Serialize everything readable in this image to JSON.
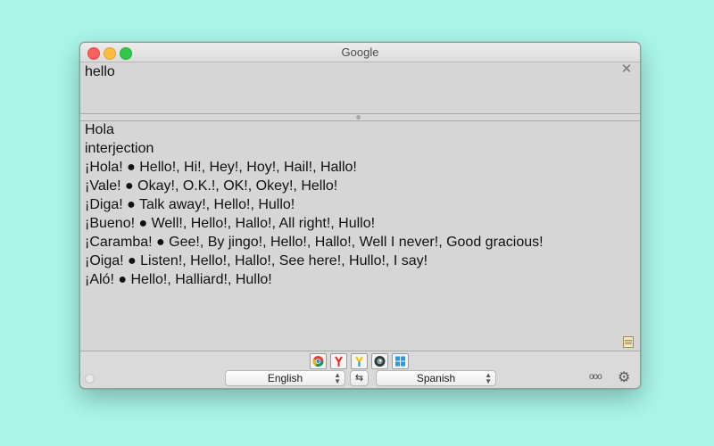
{
  "window": {
    "title": "Google"
  },
  "input": {
    "text": "hello"
  },
  "output": {
    "lines": [
      " Hola",
      "interjection",
      "¡Hola! ● Hello!, Hi!, Hey!, Hoy!, Hail!, Hallo!",
      "¡Vale! ● Okay!, O.K.!, OK!, Okey!, Hello!",
      "¡Diga! ● Talk away!, Hello!, Hullo!",
      "¡Bueno! ● Well!, Hello!, Hallo!, All right!, Hullo!",
      "¡Caramba! ● Gee!, By jingo!, Hello!, Hallo!, Well I never!, Good gracious!",
      "¡Oiga! ● Listen!, Hello!, Hallo!, See here!, Hullo!, I say!",
      "¡Aló! ● Hello!, Halliard!, Hullo!"
    ]
  },
  "engines": [
    "google-engine",
    "yandex-engine",
    "yandex-alt-engine",
    "deepl-engine",
    "bing-engine"
  ],
  "languages": {
    "source": "English",
    "target": "Spanish"
  },
  "colors": {
    "background": "#aaf5e8",
    "window": "#d6d6d6"
  }
}
